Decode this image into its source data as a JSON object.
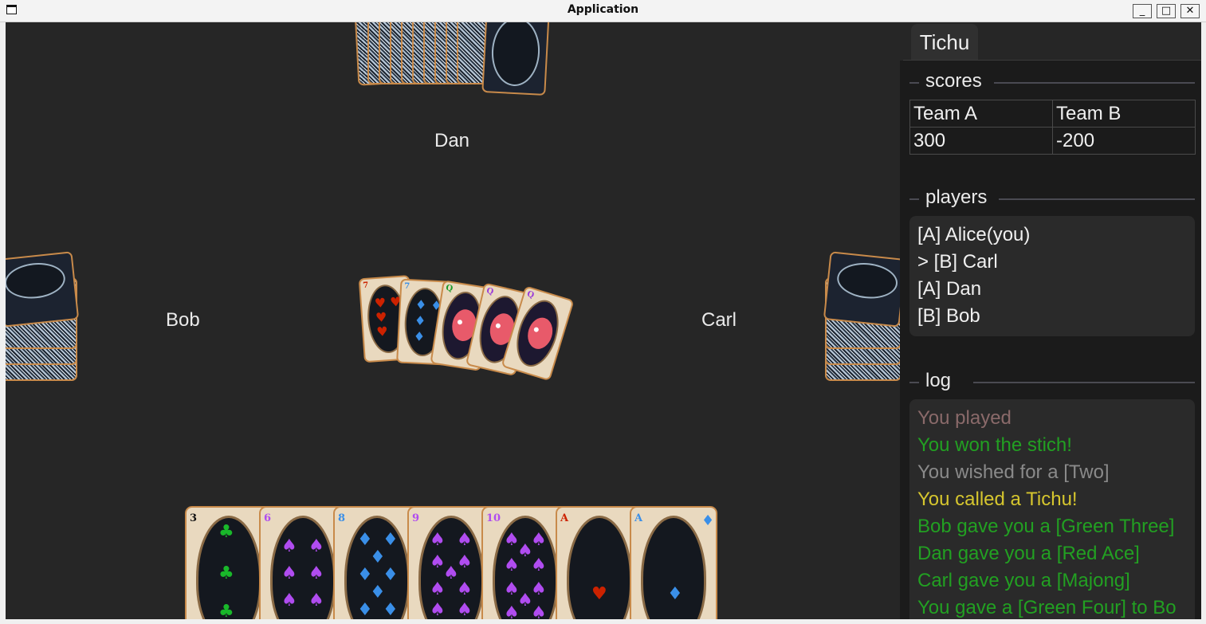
{
  "window": {
    "title": "Application",
    "minimize_label": "_",
    "maximize_label": "□",
    "close_label": "✕"
  },
  "game": {
    "players": {
      "top": "Dan",
      "left": "Bob",
      "right": "Carl"
    },
    "table_cards": [
      {
        "rank": "7",
        "suit": "hearts",
        "color": "#cc2200"
      },
      {
        "rank": "7",
        "suit": "diamonds",
        "color": "#3a8fe8"
      },
      {
        "rank": "Q",
        "suit": "clubs",
        "color": "#1a9a2a"
      },
      {
        "rank": "Q",
        "suit": "spades",
        "color": "#9b3dd9"
      },
      {
        "rank": "Q",
        "suit": "spades",
        "color": "#9b3dd9"
      }
    ],
    "hand": [
      {
        "rank": "3",
        "pip": "♣",
        "color": "#19b82a"
      },
      {
        "rank": "6",
        "pip": "♠",
        "color": "#b04cf0"
      },
      {
        "rank": "8",
        "pip": "♦",
        "color": "#3a8fe8"
      },
      {
        "rank": "9",
        "pip": "♠",
        "color": "#b04cf0"
      },
      {
        "rank": "10",
        "pip": "♠",
        "color": "#b04cf0"
      },
      {
        "rank": "A",
        "pip": "♥",
        "color": "#cc2200"
      },
      {
        "rank": "A",
        "pip": "♦",
        "color": "#3a8fe8"
      }
    ]
  },
  "sidebar": {
    "tab": "Tichu",
    "scores": {
      "heading": "scores",
      "headers": [
        "Team A",
        "Team B"
      ],
      "values": [
        "300",
        "-200"
      ]
    },
    "players": {
      "heading": "players",
      "items": [
        "[A] Alice(you)",
        "> [B] Carl",
        "[A] Dan",
        "[B] Bob"
      ]
    },
    "log": {
      "heading": "log",
      "entries": [
        {
          "text": "You played",
          "color": "#8a6a6a"
        },
        {
          "text": "You won the stich!",
          "color": "#22a022"
        },
        {
          "text": "You wished for a [Two]",
          "color": "#8a8a8a"
        },
        {
          "text": "You called a Tichu!",
          "color": "#d6c62e"
        },
        {
          "text": "Bob gave you a [Green Three]",
          "color": "#22a022"
        },
        {
          "text": "Dan gave you a [Red Ace]",
          "color": "#22a022"
        },
        {
          "text": "Carl gave you a [Majong]",
          "color": "#22a022"
        },
        {
          "text": "You gave a [Green Four] to Bo",
          "color": "#22a022"
        }
      ]
    }
  }
}
